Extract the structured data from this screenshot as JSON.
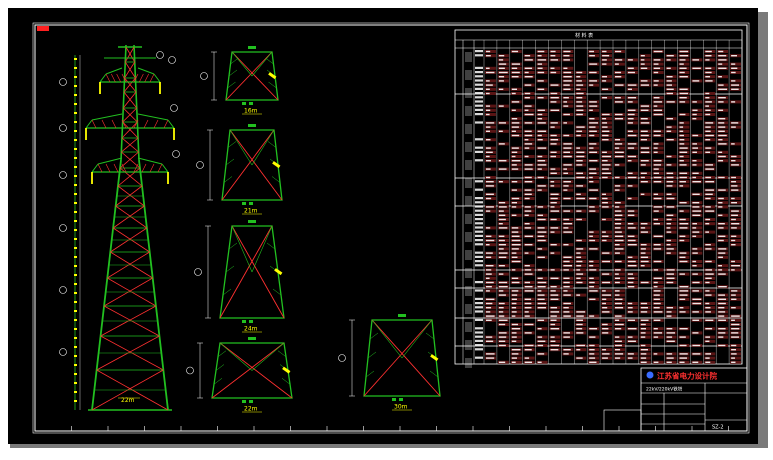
{
  "title_block": {
    "company": "江苏省电力设计院",
    "drawing_title": "22kV/220kV铁塔",
    "drawing_no": "SZ-2"
  },
  "tower": {
    "main_base_label": "22m"
  },
  "panels": [
    {
      "label": "16m"
    },
    {
      "label": "21m"
    },
    {
      "label": "24m"
    },
    {
      "label": "22m"
    },
    {
      "label": "30m"
    }
  ],
  "table": {
    "header_title": "材 料 表"
  },
  "colors": {
    "background": "#000000",
    "outline": "#ffffff",
    "tower_frame": "#22c020",
    "bracing": "#ff3030",
    "labels": "#ffff00",
    "table_fill": "#5a1414"
  }
}
